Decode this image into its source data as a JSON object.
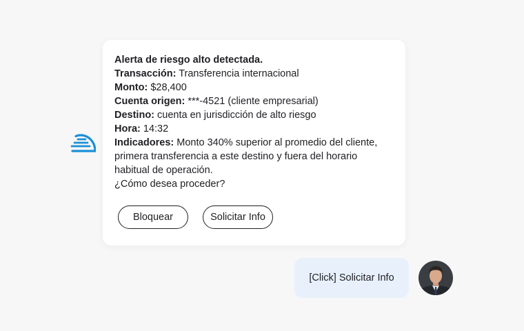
{
  "chat": {
    "bot_message": {
      "title": "Alerta de riesgo alto detectada.",
      "fields": [
        {
          "label": "Transacción:",
          "value": " Transferencia internacional"
        },
        {
          "label": "Monto:",
          "value": " $28,400"
        },
        {
          "label": "Cuenta origen:",
          "value": " ***-4521 (cliente empresarial)"
        },
        {
          "label": "Destino:",
          "value": " cuenta en jurisdicción de alto riesgo"
        },
        {
          "label": "Hora:",
          "value": " 14:32"
        },
        {
          "label": "Indicadores:",
          "value": " Monto 340% superior al promedio del cliente, primera transferencia a este destino y fuera del horario habitual de operación."
        }
      ],
      "question": "¿Cómo desea proceder?",
      "actions": {
        "block_label": "Bloquear",
        "request_info_label": "Solicitar Info"
      }
    },
    "user_message": {
      "text": "[Click] Solicitar Info"
    },
    "bot_icon": "speed-dome-logo-icon",
    "user_avatar": "user-avatar-photo",
    "colors": {
      "accent": "#1a8fd6",
      "user_bubble": "#e8f1fb",
      "card": "#ffffff",
      "background": "#f7f7f7"
    }
  }
}
